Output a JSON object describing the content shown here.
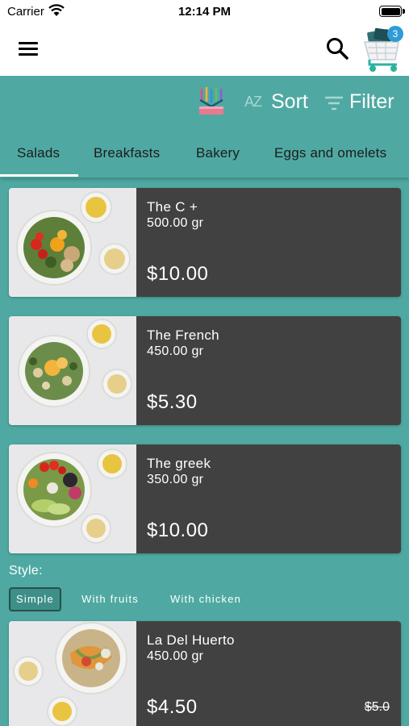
{
  "status_bar": {
    "carrier": "Carrier",
    "time": "12:14 PM"
  },
  "cart": {
    "badge_count": "3"
  },
  "toolbar": {
    "sort_az": "AZ",
    "sort_label": "Sort",
    "filter_label": "Filter"
  },
  "tabs": [
    {
      "label": "Salads",
      "active": true
    },
    {
      "label": "Breakfasts"
    },
    {
      "label": "Bakery"
    },
    {
      "label": "Eggs and omelets"
    }
  ],
  "products": [
    {
      "name": "The C +",
      "weight": "500.00 gr",
      "price": "$10.00"
    },
    {
      "name": "The French",
      "weight": "450.00 gr",
      "price": "$5.30"
    },
    {
      "name": "The greek",
      "weight": "350.00 gr",
      "price": "$10.00"
    },
    {
      "name": "La Del Huerto",
      "weight": "450.00 gr",
      "price": "$4.50",
      "old_price": "$5.0"
    }
  ],
  "style_filter": {
    "label": "Style:",
    "options": [
      {
        "label": "Simple",
        "selected": true
      },
      {
        "label": "With fruits"
      },
      {
        "label": "With chicken"
      }
    ]
  },
  "colors": {
    "background": "#4fa9a2",
    "card": "#414141",
    "badge": "#2e9bd6"
  }
}
